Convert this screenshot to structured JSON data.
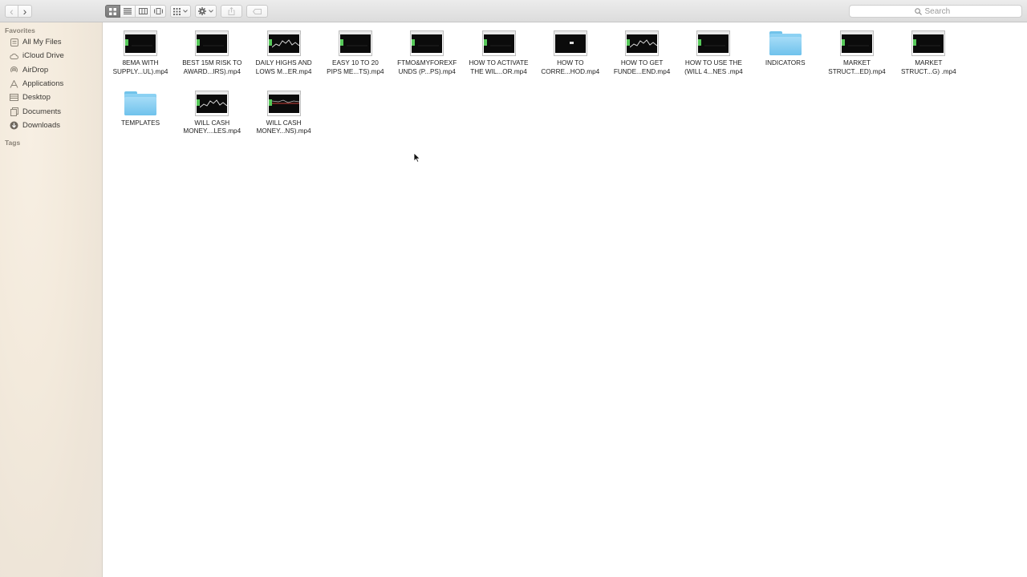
{
  "toolbar": {
    "back_glyph": "‹",
    "forward_glyph": "›",
    "search": {
      "placeholder": "Search"
    }
  },
  "sidebar": {
    "favorites_header": "Favorites",
    "tags_header": "Tags",
    "items": [
      {
        "label": "All My Files",
        "icon": "all-files-icon"
      },
      {
        "label": "iCloud Drive",
        "icon": "cloud-icon"
      },
      {
        "label": "AirDrop",
        "icon": "airdrop-icon"
      },
      {
        "label": "Applications",
        "icon": "applications-icon"
      },
      {
        "label": "Desktop",
        "icon": "desktop-icon"
      },
      {
        "label": "Documents",
        "icon": "documents-icon"
      },
      {
        "label": "Downloads",
        "icon": "downloads-icon"
      }
    ]
  },
  "files": [
    {
      "name": "8EMA WITH\nSUPPLY...UL).mp4",
      "kind": "video"
    },
    {
      "name": "BEST 15M RISK TO\nAWARD...IRS).mp4",
      "kind": "video"
    },
    {
      "name": "DAILY HIGHS AND\nLOWS M...ER.mp4",
      "kind": "video-chart"
    },
    {
      "name": "EASY 10 TO 20\nPIPS ME...TS).mp4",
      "kind": "video"
    },
    {
      "name": "FTMO&MYFOREXF\nUNDS (P...PS).mp4",
      "kind": "video"
    },
    {
      "name": "HOW TO ACTIVATE\nTHE WIL...OR.mp4",
      "kind": "video"
    },
    {
      "name": "HOW TO\nCORRE...HOD.mp4",
      "kind": "video-dark"
    },
    {
      "name": "HOW TO GET\nFUNDE...END.mp4",
      "kind": "video-chart"
    },
    {
      "name": "HOW TO USE THE\n(WILL 4...NES .mp4",
      "kind": "video"
    },
    {
      "name": "INDICATORS",
      "kind": "folder"
    },
    {
      "name": "MARKET\nSTRUCT...ED).mp4",
      "kind": "video"
    },
    {
      "name": "MARKET\nSTRUCT...G) .mp4",
      "kind": "video"
    },
    {
      "name": "TEMPLATES",
      "kind": "folder"
    },
    {
      "name": "WILL CASH\nMONEY....LES.mp4",
      "kind": "video-chart"
    },
    {
      "name": "WILL CASH\nMONEY...NS).mp4",
      "kind": "video-red"
    }
  ]
}
